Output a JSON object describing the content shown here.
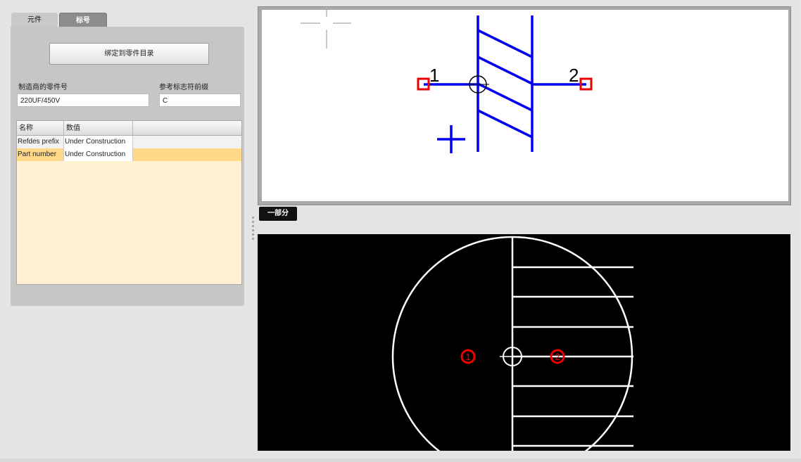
{
  "tabs": [
    {
      "label": "元件"
    },
    {
      "label": "标号"
    }
  ],
  "bind_button": {
    "label": "绑定到零件目录"
  },
  "fields": {
    "mfr_part": {
      "label": "制造商的零件号",
      "value": "220UF/450V"
    },
    "refdes_prefix": {
      "label": "参考标志符前缀",
      "value": "C"
    }
  },
  "grid": {
    "headers": [
      "名称",
      "数值"
    ],
    "rows": [
      {
        "name": "Refdes prefix",
        "value": "Under Construction"
      },
      {
        "name": "Part number",
        "value": "Under Construction"
      }
    ]
  },
  "symbol": {
    "pin_labels": [
      "1",
      "2"
    ]
  },
  "part_tab": {
    "label": "一部分"
  },
  "footprint": {
    "pad_labels": [
      "1",
      "2"
    ]
  },
  "colors": {
    "symbol_stroke": "#0000ee",
    "pin_marker": "#ee0000",
    "footprint_stroke": "#ffffff",
    "selected_row": "#ffd88a",
    "grid_background": "#fff1d2"
  }
}
